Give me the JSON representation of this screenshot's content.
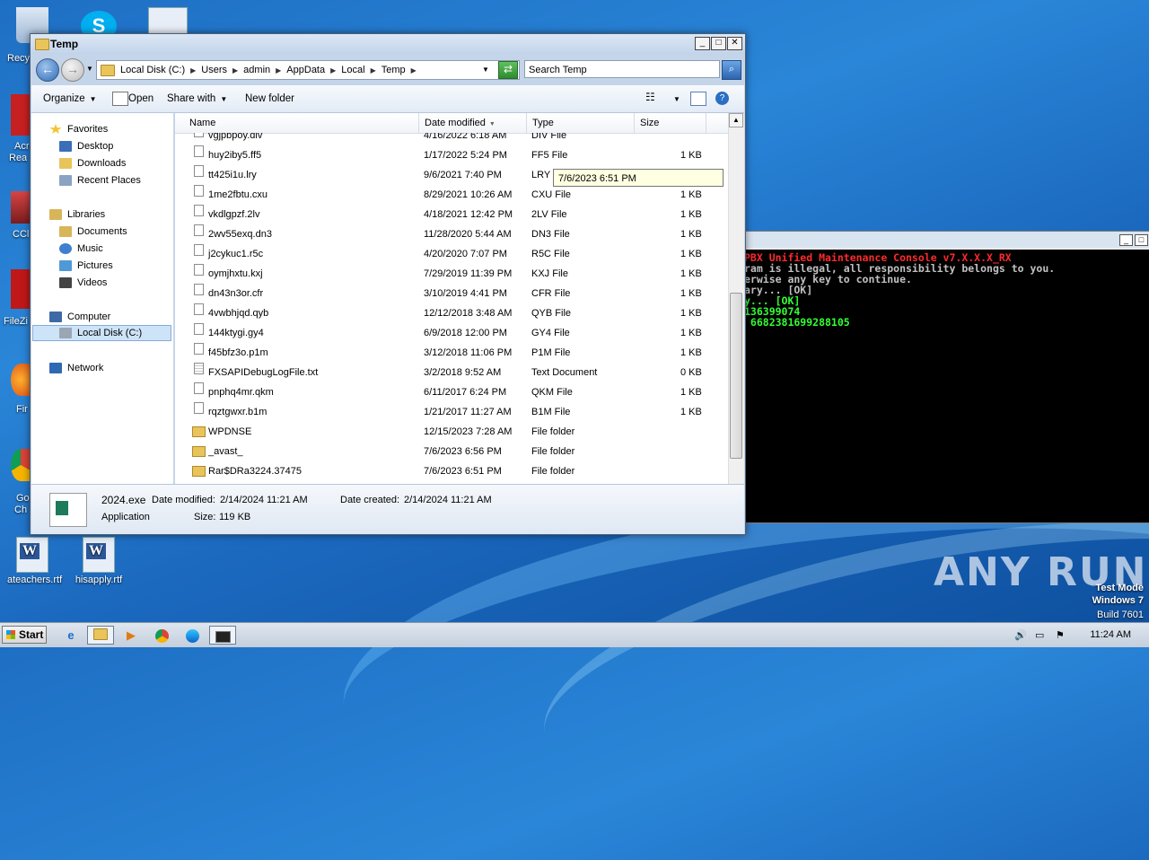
{
  "explorer": {
    "title": "Temp",
    "breadcrumb": [
      "Local Disk (C:)",
      "Users",
      "admin",
      "AppData",
      "Local",
      "Temp"
    ],
    "search_placeholder": "Search Temp",
    "toolbar": {
      "organize": "Organize",
      "open": "Open",
      "share_with": "Share with",
      "new_folder": "New folder"
    },
    "nav": {
      "favorites": "Favorites",
      "desktop": "Desktop",
      "downloads": "Downloads",
      "recent_places": "Recent Places",
      "libraries": "Libraries",
      "documents": "Documents",
      "music": "Music",
      "pictures": "Pictures",
      "videos": "Videos",
      "computer": "Computer",
      "local_disk": "Local Disk (C:)",
      "network": "Network"
    },
    "columns": [
      "Name",
      "Date modified",
      "Type",
      "Size"
    ],
    "rows": [
      {
        "name": "vgjpbpoy.div",
        "date": "4/16/2022 6:18 AM",
        "type": "DIV File",
        "size": "",
        "kind": "file"
      },
      {
        "name": "huy2iby5.ff5",
        "date": "1/17/2022 5:24 PM",
        "type": "FF5 File",
        "size": "1 KB",
        "kind": "file"
      },
      {
        "name": "tt425i1u.lry",
        "date": "9/6/2021 7:40 PM",
        "type": "LRY File",
        "size": "1 KB",
        "kind": "file"
      },
      {
        "name": "1me2fbtu.cxu",
        "date": "8/29/2021 10:26 AM",
        "type": "CXU File",
        "size": "1 KB",
        "kind": "file"
      },
      {
        "name": "vkdlgpzf.2lv",
        "date": "4/18/2021 12:42 PM",
        "type": "2LV File",
        "size": "1 KB",
        "kind": "file"
      },
      {
        "name": "2wv55exq.dn3",
        "date": "11/28/2020 5:44 AM",
        "type": "DN3 File",
        "size": "1 KB",
        "kind": "file"
      },
      {
        "name": "j2cykuc1.r5c",
        "date": "4/20/2020 7:07 PM",
        "type": "R5C File",
        "size": "1 KB",
        "kind": "file"
      },
      {
        "name": "oymjhxtu.kxj",
        "date": "7/29/2019 11:39 PM",
        "type": "KXJ File",
        "size": "1 KB",
        "kind": "file"
      },
      {
        "name": "dn43n3or.cfr",
        "date": "3/10/2019 4:41 PM",
        "type": "CFR File",
        "size": "1 KB",
        "kind": "file"
      },
      {
        "name": "4vwbhjqd.qyb",
        "date": "12/12/2018 3:48 AM",
        "type": "QYB File",
        "size": "1 KB",
        "kind": "file"
      },
      {
        "name": "144ktygi.gy4",
        "date": "6/9/2018 12:00 PM",
        "type": "GY4 File",
        "size": "1 KB",
        "kind": "file"
      },
      {
        "name": "f45bfz3o.p1m",
        "date": "3/12/2018 11:06 PM",
        "type": "P1M File",
        "size": "1 KB",
        "kind": "file"
      },
      {
        "name": "FXSAPIDebugLogFile.txt",
        "date": "3/2/2018 9:52 AM",
        "type": "Text Document",
        "size": "0 KB",
        "kind": "txt"
      },
      {
        "name": "pnphq4mr.qkm",
        "date": "6/11/2017 6:24 PM",
        "type": "QKM File",
        "size": "1 KB",
        "kind": "file"
      },
      {
        "name": "rqztgwxr.b1m",
        "date": "1/21/2017 11:27 AM",
        "type": "B1M File",
        "size": "1 KB",
        "kind": "file"
      },
      {
        "name": "WPDNSE",
        "date": "12/15/2023 7:28 AM",
        "type": "File folder",
        "size": "",
        "kind": "folder"
      },
      {
        "name": "_avast_",
        "date": "7/6/2023 6:56 PM",
        "type": "File folder",
        "size": "",
        "kind": "folder"
      },
      {
        "name": "Rar$DRa3224.37475",
        "date": "7/6/2023 6:51 PM",
        "type": "File folder",
        "size": "",
        "kind": "folder"
      }
    ],
    "tooltip": "7/6/2023 6:51 PM",
    "details": {
      "filename": "2024.exe",
      "modified_label": "Date modified:",
      "modified_value": "2/14/2024 11:21 AM",
      "created_label": "Date created:",
      "created_value": "2/14/2024 11:21 AM",
      "kind": "Application",
      "size_label": "Size:",
      "size_value": "119 KB"
    }
  },
  "console": {
    "lines": [
      {
        "text": "PBX Unified Maintenance Console v7.X.X.X_RX",
        "color": "red"
      },
      {
        "text": "ram is illegal, all responsibility belongs to you.",
        "color": "gray"
      },
      {
        "text": "erwise any key to continue.",
        "color": "gray"
      },
      {
        "text": "ary... [OK]",
        "color": "gray"
      },
      {
        "text": "y... [OK]",
        "color": "green"
      },
      {
        "text": "136399074",
        "color": "green"
      },
      {
        "text": " 6682381699288105",
        "color": "green"
      }
    ]
  },
  "desktop": {
    "icons": [
      {
        "label": "ateachers.rtf"
      },
      {
        "label": "hisapply.rtf"
      }
    ],
    "edge_labels": [
      "Recy",
      "Acr",
      "Rea",
      "CCl",
      "FileZi",
      "Fir",
      "Go",
      "Ch"
    ]
  },
  "watermark": "ANY RUN",
  "os": {
    "mode": "Test Mode",
    "name": "Windows 7",
    "build": "Build 7601"
  },
  "taskbar": {
    "start": "Start",
    "clock": "11:24 AM"
  }
}
